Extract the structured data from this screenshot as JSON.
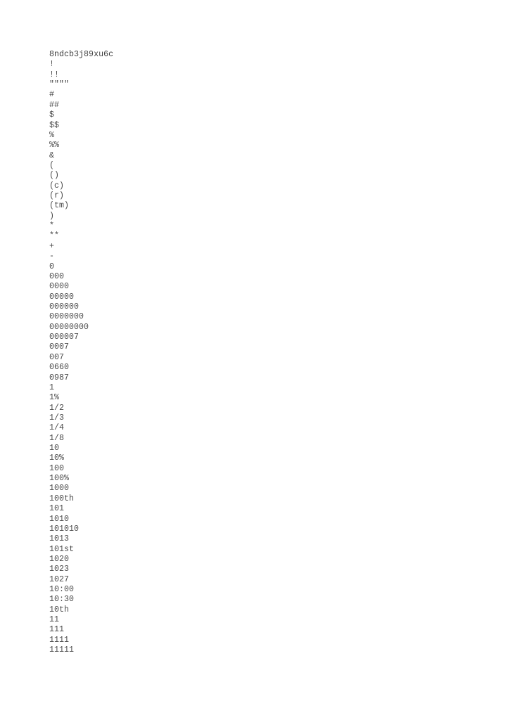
{
  "document": {
    "kind": "plain-text-listing",
    "page_background": "#ffffff",
    "text_color": "#4a4a4a",
    "header_id": "8ndcb3j89xu6c",
    "lines": [
      "8ndcb3j89xu6c",
      "!",
      "!!",
      "\"\"\"\"",
      "#",
      "##",
      "$",
      "$$",
      "%",
      "%%",
      "&",
      "(",
      "()",
      "(c)",
      "(r)",
      "(tm)",
      ")",
      "*",
      "**",
      "+",
      "-",
      "0",
      "000",
      "0000",
      "00000",
      "000000",
      "0000000",
      "00000000",
      "000007",
      "0007",
      "007",
      "0660",
      "0987",
      "1",
      "1%",
      "1/2",
      "1/3",
      "1/4",
      "1/8",
      "10",
      "10%",
      "100",
      "100%",
      "1000",
      "100th",
      "101",
      "1010",
      "101010",
      "1013",
      "101st",
      "1020",
      "1023",
      "1027",
      "10:00",
      "10:30",
      "10th",
      "11",
      "111",
      "1111",
      "11111"
    ]
  }
}
